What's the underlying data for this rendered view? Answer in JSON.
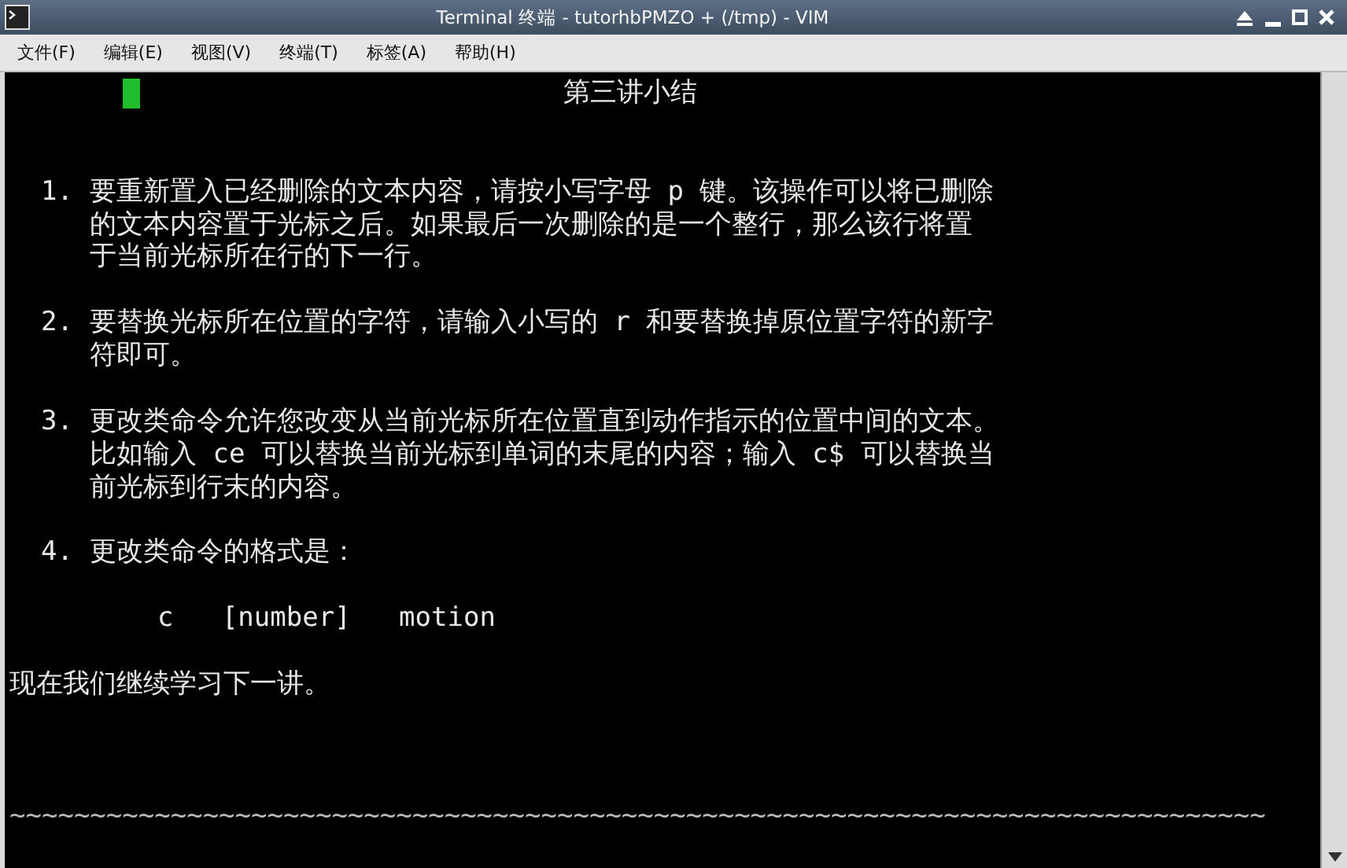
{
  "window": {
    "title": "Terminal 终端 - tutorhbPMZO + (/tmp) - VIM"
  },
  "menu": [
    {
      "label": "文件(F)"
    },
    {
      "label": "编辑(E)"
    },
    {
      "label": "视图(V)"
    },
    {
      "label": "终端(T)"
    },
    {
      "label": "标签(A)"
    },
    {
      "label": "帮助(H)"
    }
  ],
  "blocks": [
    {
      "kind": "heading",
      "lines": [
        "第三讲小结"
      ]
    },
    {
      "kind": "item",
      "number": "1.",
      "lines": [
        "要重新置入已经删除的文本内容，请按小写字母 p 键。该操作可以将已删除",
        "的文本内容置于光标之后。如果最后一次删除的是一个整行，那么该行将置",
        "于当前光标所在行的下一行。"
      ]
    },
    {
      "kind": "item",
      "number": "2.",
      "lines": [
        "要替换光标所在位置的字符，请输入小写的 r 和要替换掉原位置字符的新字",
        "符即可。"
      ]
    },
    {
      "kind": "item",
      "number": "3.",
      "lines": [
        "更改类命令允许您改变从当前光标所在位置直到动作指示的位置中间的文本。",
        "比如输入 ce 可以替换当前光标到单词的末尾的内容；输入 c$ 可以替换当",
        "前光标到行末的内容。"
      ]
    },
    {
      "kind": "item",
      "number": "4.",
      "lines": [
        "更改类命令的格式是："
      ]
    },
    {
      "kind": "code",
      "lines": [
        "c   [number]   motion"
      ]
    },
    {
      "kind": "text",
      "lines": [
        "现在我们继续学习下一讲。"
      ]
    },
    {
      "kind": "filler",
      "lines": [
        "~~~~~~~~~~~~~~~~~~~~~~~~~~~~~~~~~~~~~~~~~~~~~~~~~~~~~~~~~~~~~~~~~~~~~~~~~~~~~~"
      ]
    }
  ]
}
